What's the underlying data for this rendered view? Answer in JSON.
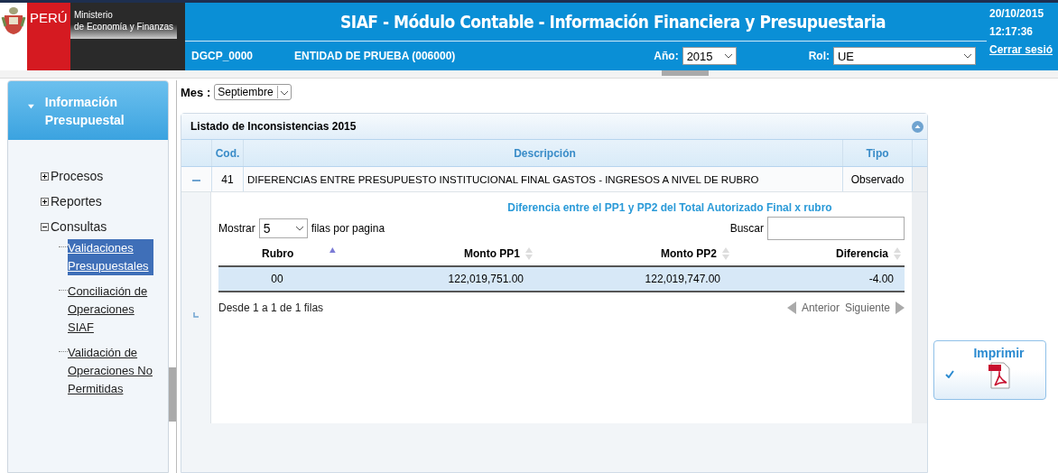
{
  "header": {
    "logo_text": "PERÚ",
    "ministry_line1": "Ministerio",
    "ministry_line2": "de Economía y Finanzas",
    "title": "SIAF - Módulo Contable - Información Financiera y Presupuestaria",
    "user_code": "DGCP_0000",
    "entity": "ENTIDAD DE PRUEBA (006000)",
    "year_label": "Año:",
    "year_value": "2015",
    "role_label": "Rol:",
    "role_value": "UE",
    "date": "20/10/2015",
    "time": "12:17:36",
    "logout": "Cerrar sesió"
  },
  "sidebar": {
    "section_title": "Información Presupuestal",
    "expanded": true,
    "tree": [
      {
        "label": "Procesos",
        "expanded": false
      },
      {
        "label": "Reportes",
        "expanded": false
      },
      {
        "label": "Consultas",
        "expanded": true,
        "children": [
          {
            "label": "Validaciones Presupuestales",
            "selected": true
          },
          {
            "label": "Conciliación de Operaciones SIAF",
            "selected": false
          },
          {
            "label": "Validación de Operaciones No Permitidas",
            "selected": false
          }
        ]
      }
    ]
  },
  "content": {
    "month_label": "Mes :",
    "month_value": "Septiembre",
    "panel_title": "Listado de Inconsistencias 2015",
    "columns": [
      "Cod.",
      "Descripción",
      "Tipo"
    ],
    "rows": [
      {
        "expanded": true,
        "code": "41",
        "description": "DIFERENCIAS ENTRE PRESUPUESTO INSTITUCIONAL FINAL GASTOS - INGRESOS A NIVEL DE RUBRO",
        "type": "Observado",
        "detail": {
          "title": "Diferencia entre el PP1 y PP2 del Total Autorizado Final x rubro",
          "show_label": "Mostrar",
          "page_size": "5",
          "per_page_label": "filas por pagina",
          "search_label": "Buscar",
          "columns": [
            {
              "label": "Rubro",
              "sorted": true
            },
            {
              "label": "Monto PP1",
              "sorted": false
            },
            {
              "label": "Monto PP2",
              "sorted": false
            },
            {
              "label": "Diferencia",
              "sorted": false
            }
          ],
          "rows": [
            {
              "selected": true,
              "cells": [
                "00",
                "122,019,751.00",
                "122,019,747.00",
                "-4.00"
              ]
            }
          ],
          "info": "Desde 1 a 1 de 1 filas",
          "prev": "Anterior",
          "next": "Siguiente"
        }
      }
    ]
  },
  "print_button": {
    "label": "Imprimir"
  }
}
